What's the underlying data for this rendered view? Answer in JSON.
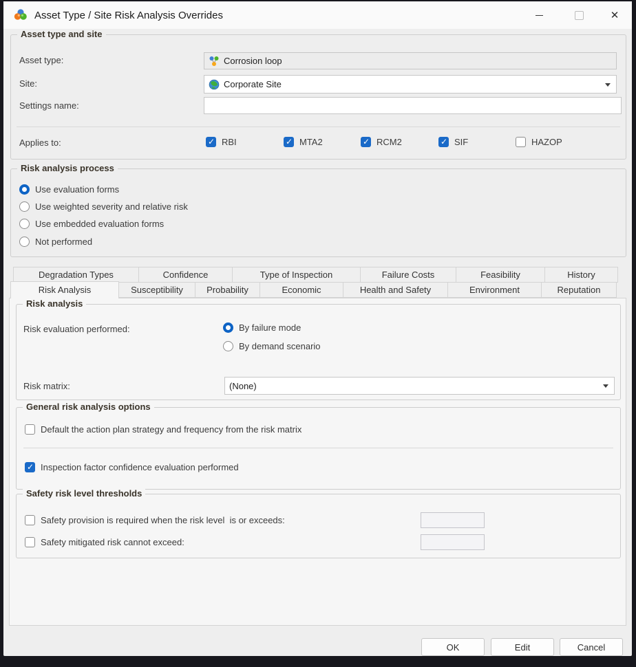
{
  "window": {
    "title": "Asset Type / Site Risk Analysis Overrides",
    "controls": {
      "close_glyph": "✕"
    }
  },
  "icons": {
    "app": "colored-spheres-cluster",
    "asset_type": "linked-nodes",
    "site": "globe",
    "combo": "chevron-down"
  },
  "asset_site": {
    "title": "Asset type and site",
    "asset_type_label": "Asset type:",
    "asset_type_value": "Corrosion loop",
    "site_label": "Site:",
    "site_value": "Corporate Site",
    "settings_name_label": "Settings name:",
    "settings_name_value": "",
    "applies_to_label": "Applies to:",
    "applies_to": [
      {
        "label": "RBI",
        "checked": true
      },
      {
        "label": "MTA2",
        "checked": true
      },
      {
        "label": "RCM2",
        "checked": true
      },
      {
        "label": "SIF",
        "checked": true
      },
      {
        "label": "HAZOP",
        "checked": false
      }
    ]
  },
  "process": {
    "title": "Risk analysis process",
    "options": [
      {
        "label": "Use evaluation forms",
        "selected": true
      },
      {
        "label": "Use weighted severity and relative risk",
        "selected": false
      },
      {
        "label": "Use embedded evaluation forms",
        "selected": false
      },
      {
        "label": "Not performed",
        "selected": false
      }
    ]
  },
  "tabs": {
    "row1": [
      "Degradation Types",
      "Confidence",
      "Type of Inspection",
      "Failure Costs",
      "Feasibility",
      "History"
    ],
    "row2": [
      "Risk Analysis",
      "Susceptibility",
      "Probability",
      "Economic",
      "Health and Safety",
      "Environment",
      "Reputation"
    ],
    "active": "Risk Analysis"
  },
  "risk_analysis": {
    "title": "Risk analysis",
    "evaluation_label": "Risk evaluation performed:",
    "options": [
      {
        "label": "By failure mode",
        "selected": true
      },
      {
        "label": "By demand scenario",
        "selected": false
      }
    ],
    "matrix_label": "Risk matrix:",
    "matrix_value": "(None)"
  },
  "general_options": {
    "title": "General risk analysis options",
    "options": [
      {
        "label": "Default the action plan strategy and frequency from the risk matrix",
        "checked": false
      },
      {
        "label": "Inspection factor confidence evaluation performed",
        "checked": true
      }
    ]
  },
  "safety": {
    "title": "Safety risk level thresholds",
    "options": [
      {
        "label": "Safety provision is required when the risk level  is or exceeds:",
        "checked": false,
        "value": ""
      },
      {
        "label": "Safety mitigated risk cannot exceed:",
        "checked": false,
        "value": ""
      }
    ]
  },
  "buttons": {
    "ok": "OK",
    "edit": "Edit",
    "cancel": "Cancel"
  },
  "colors": {
    "accent_blue": "#1a6ac8",
    "radio_blue": "#0d63c5",
    "window_border": "#17171d",
    "dialog_bg": "#eeeeee",
    "panel_bg": "#f6f6f6"
  }
}
